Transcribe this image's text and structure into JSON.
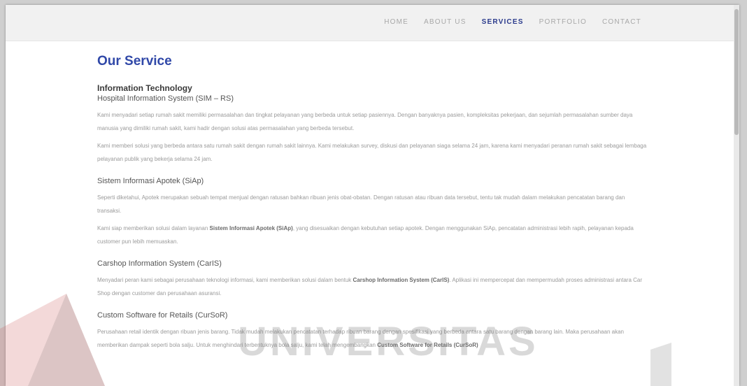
{
  "nav": {
    "items": [
      {
        "label": "HOME",
        "active": false
      },
      {
        "label": "ABOUT US",
        "active": false
      },
      {
        "label": "SERVICES",
        "active": true
      },
      {
        "label": "PORTFOLIO",
        "active": false
      },
      {
        "label": "CONTACT",
        "active": false
      }
    ]
  },
  "page_title": "Our Service",
  "section_title": "Information Technology",
  "services": [
    {
      "title": "Hospital Information System (SIM – RS)",
      "p1": "Kami menyadari setiap rumah sakit memiliki permasalahan dan tingkat pelayanan yang berbeda untuk setiap pasiennya. Dengan banyaknya pasien, kompleksitas pekerjaan, dan sejumlah permasalahan sumber daya manusia yang dimiliki rumah sakit, kami hadir dengan solusi atas permasalahan yang berbeda tersebut.",
      "p2": "Kami memberi solusi yang berbeda antara satu rumah sakit dengan rumah sakit lainnya. Kami melakukan survey, diskusi dan pelayanan siaga selama 24 jam, karena kami menyadari peranan rumah sakit sebagai lembaga pelayanan publik yang bekerja selama 24 jam."
    },
    {
      "title": "Sistem Informasi Apotek (SiAp)",
      "p1": "Seperti diketahui, Apotek merupakan sebuah tempat menjual dengan ratusan bahkan ribuan jenis obat-obatan. Dengan ratusan atau ribuan data tersebut, tentu tak mudah dalam melakukan pencatatan barang dan transaksi.",
      "p2a": "Kami siap memberikan solusi dalam layanan ",
      "p2b": "Sistem Informasi Apotek (SiAp)",
      "p2c": ", yang disesuaikan dengan kebutuhan setiap apotek. Dengan menggunakan SiAp, pencatatan administrasi lebih rapih, pelayanan kepada customer pun lebih memuaskan."
    },
    {
      "title": "Carshop Information System (CarIS)",
      "p1a": "Menyadari peran kami sebagai perusahaan teknologi informasi, kami memberikan solusi dalam bentuk ",
      "p1b": "Carshop Information System (CarIS)",
      "p1c": ". Aplikasi ini mempercepat dan mempermudah proses administrasi antara Car Shop dengan customer dan perusahaan asuransi."
    },
    {
      "title": "Custom Software for Retails (CurSoR)",
      "p1": "Perusahaan retail identik dengan ribuan jenis barang. Tidak mudah melakukan pencatatan terhadap ribuan barang dengan spesifikasi yang berbeda antara satu barang dengan barang lain. Maka perusahaan akan memberikan dampak seperti bola salju. Untuk menghindari terbentuknya bola salju, kami telah mengembangkan",
      "p1b": "Custom Software for Retails (CurSoR)"
    }
  ],
  "watermark": {
    "text": "UNIVERSITAS"
  }
}
